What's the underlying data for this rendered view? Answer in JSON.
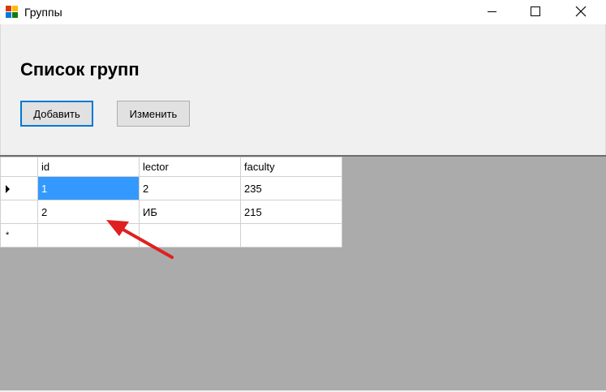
{
  "window": {
    "title": "Группы",
    "icon": "app-icon"
  },
  "form": {
    "heading": "Список групп",
    "add_label": "Добавить",
    "edit_label": "Изменить"
  },
  "grid": {
    "columns": [
      "id",
      "lector",
      "faculty"
    ],
    "rows": [
      {
        "id": "1",
        "lector": "2",
        "faculty": "235"
      },
      {
        "id": "2",
        "lector": "ИБ",
        "faculty": "215"
      }
    ],
    "new_row_marker": "*",
    "selected_color": "#3399ff",
    "background_color": "#ababab"
  },
  "annotation": {
    "type": "red-arrow",
    "color": "#e02020"
  }
}
